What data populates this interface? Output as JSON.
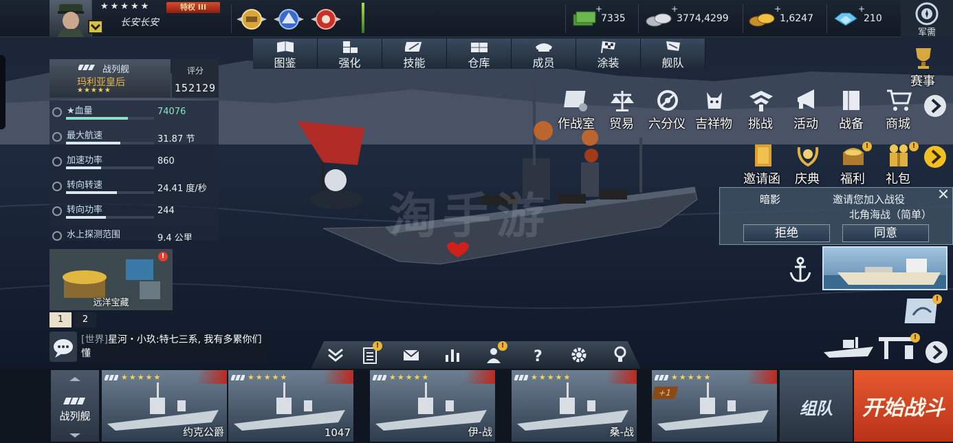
{
  "player": {
    "name": "长安长安",
    "rank_stars": "★★★★★",
    "vip_label": "特权 III"
  },
  "resources": [
    {
      "name": "cash",
      "value": "7335"
    },
    {
      "name": "silver",
      "value": "3774,4299"
    },
    {
      "name": "gold",
      "value": "1,6247"
    },
    {
      "name": "diamond",
      "value": "210"
    }
  ],
  "junxu_label": "军需",
  "tabs": [
    "图鉴",
    "强化",
    "技能",
    "仓库",
    "成员",
    "涂装",
    "舰队"
  ],
  "ship": {
    "type": "战列舰",
    "name": "玛利亚皇后",
    "stars": "★★★★★",
    "score_label": "评分",
    "score": "152129"
  },
  "stats": [
    {
      "label": "★血量",
      "value": "74076",
      "fill": 0.7,
      "highlight": true
    },
    {
      "label": "最大航速",
      "value": "31.87 节",
      "fill": 0.62
    },
    {
      "label": "加速功率",
      "value": "860",
      "fill": 0.4
    },
    {
      "label": "转向转速",
      "value": "24.41 度/秒",
      "fill": 0.58
    },
    {
      "label": "转向功率",
      "value": "244",
      "fill": 0.45
    },
    {
      "label": "水上探测范围",
      "value": "9.4 公里",
      "fill": 0.5
    }
  ],
  "treasure_label": "远洋宝藏",
  "pages": [
    "1",
    "2"
  ],
  "chat": {
    "channel": "[世界]",
    "message": "星河・小玖:特七三系, 我有多累你们懂"
  },
  "event_label": "赛事",
  "features_row1": [
    "作战室",
    "贸易",
    "六分仪",
    "吉祥物",
    "挑战",
    "活动",
    "战备",
    "商城"
  ],
  "features_row2": [
    "邀请函",
    "庆典",
    "福利",
    "礼包"
  ],
  "invite": {
    "from": "暗影",
    "message": "邀请您加入战役",
    "mode": "北角海战（简单）",
    "reject": "拒绝",
    "accept": "同意"
  },
  "watermark": "淘手游",
  "dock": {
    "ship_type": "战列舰",
    "team": "组队",
    "battle": "开始战斗",
    "cards": [
      {
        "name": "约克公爵",
        "stars": "★★★★★"
      },
      {
        "name": "1047",
        "stars": "★★★★★"
      },
      {
        "name": "伊-战",
        "stars": "★★★★★"
      },
      {
        "name": "桑-战",
        "stars": "★★★★★"
      },
      {
        "name": "",
        "stars": "★★★★★",
        "badge": "+1"
      }
    ]
  }
}
